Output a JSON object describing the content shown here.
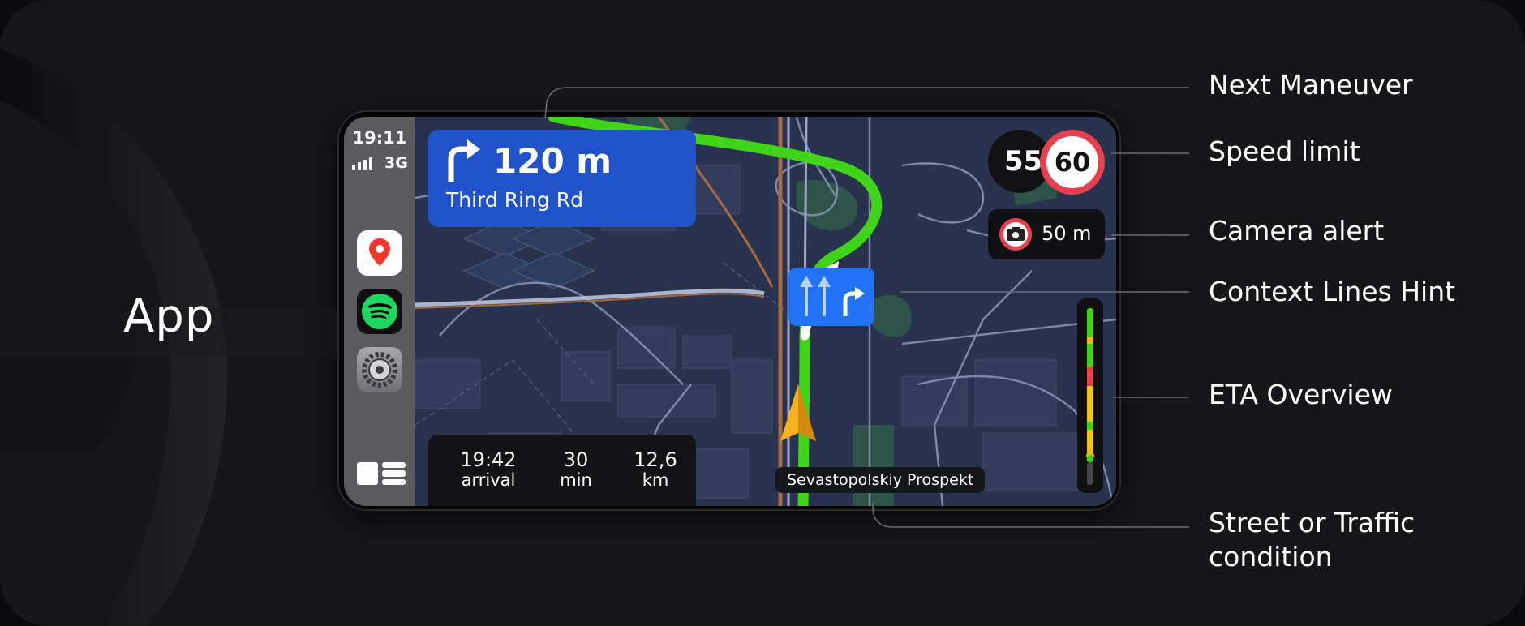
{
  "app_label": "App",
  "sidebar": {
    "time": "19:11",
    "network": "3G",
    "apps": [
      {
        "name": "maps-app-icon"
      },
      {
        "name": "spotify-app-icon"
      },
      {
        "name": "settings-app-icon"
      }
    ]
  },
  "maneuver": {
    "distance": "120 m",
    "street": "Third Ring Rd"
  },
  "speed": {
    "current": "55",
    "limit": "60"
  },
  "camera_alert": {
    "distance": "50 m"
  },
  "eta": {
    "arrival_value": "19:42",
    "arrival_label": "arrival",
    "duration_value": "30",
    "duration_label": "min",
    "distance_value": "12,6",
    "distance_label": "km"
  },
  "street_label": "Sevastopolskiy Prospekt",
  "callouts": {
    "next_maneuver": "Next Maneuver",
    "speed_limit": "Speed limit",
    "camera_alert": "Camera alert",
    "context_lines": "Context Lines Hint",
    "eta_overview": "ETA Overview",
    "street_line1": "Street or Traffic",
    "street_line2": "condition"
  },
  "colors": {
    "route": "#3fd41a",
    "maneuver_bg": "#2052c9",
    "lane_bg": "#2172f5",
    "speed_ring": "#e5404d"
  }
}
